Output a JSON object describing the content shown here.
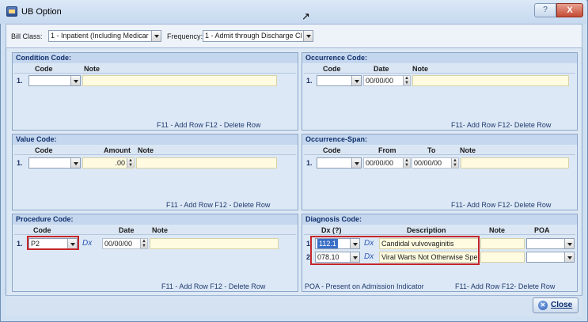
{
  "window": {
    "title": "UB Option",
    "help_glyph": "?",
    "close_glyph": "X"
  },
  "bill": {
    "bill_class_label": "Bill Class:",
    "bill_class_value": "1 - Inpatient (Including Medicar",
    "frequency_label": "Frequency:",
    "frequency_value": "1 - Admit through Discharge Cla"
  },
  "condition": {
    "title": "Condition Code:",
    "headers": {
      "code": "Code",
      "note": "Note"
    },
    "row_number": "1.",
    "footer": "F11 - Add Row  F12 - Delete Row"
  },
  "occurrence": {
    "title": "Occurrence Code:",
    "headers": {
      "code": "Code",
      "date": "Date",
      "note": "Note"
    },
    "row_number": "1.",
    "date_value": "00/00/00",
    "footer": "F11- Add Row  F12- Delete Row"
  },
  "value": {
    "title": "Value Code:",
    "headers": {
      "code": "Code",
      "amount": "Amount",
      "note": "Note"
    },
    "row_number": "1.",
    "amount_value": ".00",
    "footer": "F11 - Add Row  F12 - Delete Row"
  },
  "occurrence_span": {
    "title": "Occurrence-Span:",
    "headers": {
      "code": "Code",
      "from": "From",
      "to": "To",
      "note": "Note"
    },
    "row_number": "1.",
    "from_value": "00/00/00",
    "to_value": "00/00/00",
    "footer": "F11- Add Row  F12- Delete Row"
  },
  "procedure": {
    "title": "Procedure Code:",
    "headers": {
      "code": "Code",
      "date": "Date",
      "note": "Note"
    },
    "row_number": "1.",
    "code_value": "P2",
    "dx_label": "Dx",
    "date_value": "00/00/00",
    "footer": "F11 - Add Row  F12 - Delete Row"
  },
  "diagnosis": {
    "title": "Diagnosis Code:",
    "headers": {
      "dx": "Dx  (?)",
      "description": "Description",
      "note": "Note",
      "poa": "POA"
    },
    "rows": [
      {
        "number": "1.",
        "code": "112.1",
        "dx_label": "Dx",
        "description": "Candidal vulvovaginitis"
      },
      {
        "number": "2.",
        "code": "078.10",
        "dx_label": "Dx",
        "description": "Viral Warts Not Otherwise Spec"
      }
    ],
    "poa_note": "POA - Present on Admission Indicator",
    "footer": "F11- Add Row  F12- Delete Row"
  },
  "actions": {
    "close_label": "Close"
  },
  "colors": {
    "highlight": "#c6262b",
    "panel_title_text": "#0f2f6d"
  }
}
